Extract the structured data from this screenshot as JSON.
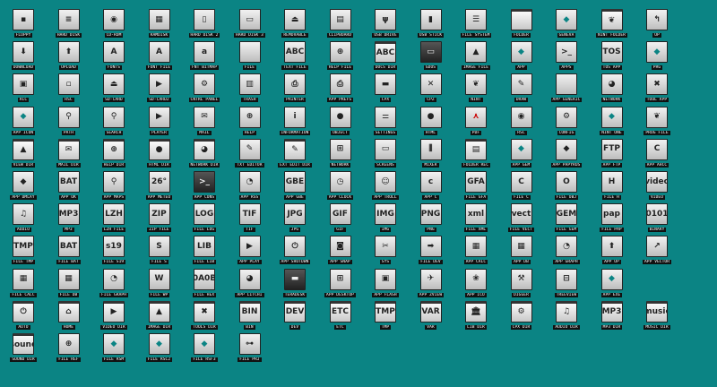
{
  "desktop": {
    "background": "#0b8484",
    "icons": [
      {
        "label": "FLOPPY",
        "icon": "floppy-icon",
        "sym": "▪"
      },
      {
        "label": "HARD DISK",
        "icon": "hard-disk-icon",
        "sym": "≡"
      },
      {
        "label": "CD-ROM",
        "icon": "cd-rom-icon",
        "sym": "◉"
      },
      {
        "label": "RAMDISK",
        "icon": "ramdisk-icon",
        "sym": "▦"
      },
      {
        "label": "HARD DISK 2",
        "icon": "hard-disk-2-icon",
        "sym": "▯"
      },
      {
        "label": "HARD DISK 3",
        "icon": "hard-disk-3-icon",
        "sym": "▭"
      },
      {
        "label": "REMOVABLE",
        "icon": "removable-icon",
        "sym": "⏏"
      },
      {
        "label": "CLIPBOARD",
        "icon": "clipboard-icon",
        "sym": "▤"
      },
      {
        "label": "USB DRIVE",
        "icon": "usb-drive-icon",
        "sym": "ψ"
      },
      {
        "label": "USB STICK",
        "icon": "usb-stick-icon",
        "sym": "▮"
      },
      {
        "label": "FILE SYSTEM",
        "icon": "file-system-icon",
        "sym": "☰"
      },
      {
        "label": "FOLDER",
        "icon": "folder-icon",
        "sym": "",
        "kind": "folder"
      },
      {
        "label": "GENEVA",
        "icon": "geneva-icon",
        "sym": "◆",
        "kind": "teal"
      },
      {
        "label": "NINT FOLDER",
        "icon": "nint-folder-icon",
        "sym": "❦",
        "kind": "folder"
      },
      {
        "label": "UP",
        "icon": "up-arrow-icon",
        "sym": "↰"
      },
      {
        "label": "DOWNLOAD",
        "icon": "download-icon",
        "sym": "⬇"
      },
      {
        "label": "UPLOAD",
        "icon": "upload-icon",
        "sym": "⬆"
      },
      {
        "label": "FONTS",
        "icon": "fonts-icon",
        "sym": "A"
      },
      {
        "label": "FONT FILE",
        "icon": "font-file-icon",
        "sym": "A"
      },
      {
        "label": "FNT BITMAP",
        "icon": "fnt-bitmap-icon",
        "sym": "a"
      },
      {
        "label": "FILE",
        "icon": "file-icon",
        "sym": ""
      },
      {
        "label": "TEXT FILE",
        "icon": "text-file-icon",
        "sym": "ABC"
      },
      {
        "label": "HELP FILE",
        "icon": "help-file-icon",
        "sym": "⊕"
      },
      {
        "label": "DOCS DIR",
        "icon": "docs-dir-icon",
        "sym": "ABC",
        "kind": "folder"
      },
      {
        "label": "GDOS",
        "icon": "gdos-icon",
        "sym": "▭",
        "kind": "dark"
      },
      {
        "label": "IMAGE FILE",
        "icon": "image-file-icon",
        "sym": "▲"
      },
      {
        "label": "APP",
        "icon": "app-icon",
        "sym": "◆",
        "kind": "teal"
      },
      {
        "label": "APPS",
        "icon": "apps-icon",
        "sym": ">_"
      },
      {
        "label": "TOS APP",
        "icon": "tos-app-icon",
        "sym": "TOS"
      },
      {
        "label": "PRG",
        "icon": "prg-icon",
        "sym": "◆",
        "kind": "teal"
      },
      {
        "label": "ACC",
        "icon": "acc-icon",
        "sym": "▣"
      },
      {
        "label": "RSC",
        "icon": "rsc-icon",
        "sym": "▫"
      },
      {
        "label": "SD-CARD",
        "icon": "sd-card-icon",
        "sym": "⏏"
      },
      {
        "label": "SD-CARD2",
        "icon": "sd-card-2-icon",
        "sym": "▶"
      },
      {
        "label": "CNTRL PANEL",
        "icon": "control-panel-icon",
        "sym": "⚙"
      },
      {
        "label": "TRASH",
        "icon": "trash-icon",
        "sym": "▥"
      },
      {
        "label": "PRINTER",
        "icon": "printer-icon",
        "sym": "⎙"
      },
      {
        "label": "APP PREFS",
        "icon": "app-prefs-icon",
        "sym": "⎙"
      },
      {
        "label": "CPX",
        "icon": "cpx-icon",
        "sym": "▬"
      },
      {
        "label": "CPZ",
        "icon": "cpz-icon",
        "sym": "✕"
      },
      {
        "label": "NINT",
        "icon": "nint-icon",
        "sym": "❦"
      },
      {
        "label": "DRAW",
        "icon": "draw-icon",
        "sym": "✎"
      },
      {
        "label": "APP GENERIC",
        "icon": "app-generic-icon",
        "sym": ""
      },
      {
        "label": "NETWORK",
        "icon": "network-icon",
        "sym": "◕"
      },
      {
        "label": "TOOL APP",
        "icon": "tool-app-icon",
        "sym": "✖"
      },
      {
        "label": "APP ICON",
        "icon": "app-icon-icon",
        "sym": "◆",
        "kind": "teal"
      },
      {
        "label": "PATH",
        "icon": "path-icon",
        "sym": "⚲"
      },
      {
        "label": "SEARCH",
        "icon": "search-icon",
        "sym": "⚲"
      },
      {
        "label": "PLAYER",
        "icon": "player-icon",
        "sym": "▶"
      },
      {
        "label": "MAIL",
        "icon": "mail-icon",
        "sym": "✉"
      },
      {
        "label": "HELP",
        "icon": "help-icon",
        "sym": "⊕"
      },
      {
        "label": "INFORMATION",
        "icon": "information-icon",
        "sym": "i"
      },
      {
        "label": "OBJECT",
        "icon": "object-icon",
        "sym": "●"
      },
      {
        "label": "SETTINGS",
        "icon": "settings-icon",
        "sym": "⚌"
      },
      {
        "label": "HTML",
        "icon": "html-icon",
        "sym": "●"
      },
      {
        "label": "PDF",
        "icon": "pdf-icon",
        "sym": "⋏",
        "kind": "red"
      },
      {
        "label": "RSC",
        "icon": "rsc-2-icon",
        "sym": "◉"
      },
      {
        "label": "CONFIG",
        "icon": "config-icon",
        "sym": "⚙"
      },
      {
        "label": "NINT ONE",
        "icon": "nint-one-icon",
        "sym": "◆",
        "kind": "teal"
      },
      {
        "label": "PROG FILE",
        "icon": "prog-file-icon",
        "sym": "❦"
      },
      {
        "label": "VIEW DIR",
        "icon": "view-dir-icon",
        "sym": "▲",
        "kind": "folder"
      },
      {
        "label": "MAIL DIR",
        "icon": "mail-dir-icon",
        "sym": "✉",
        "kind": "folder"
      },
      {
        "label": "HELP DIR",
        "icon": "help-dir-icon",
        "sym": "⊕",
        "kind": "folder"
      },
      {
        "label": "HTML DIR",
        "icon": "html-dir-icon",
        "sym": "●",
        "kind": "folder"
      },
      {
        "label": "NETWORK DIR",
        "icon": "network-dir-icon",
        "sym": "◕",
        "kind": "folder"
      },
      {
        "label": "TXT EDITOR",
        "icon": "txt-editor-icon",
        "sym": "✎"
      },
      {
        "label": "EXT EDIT DIR",
        "icon": "ext-edit-dir-icon",
        "sym": "✎",
        "kind": "folder"
      },
      {
        "label": "NETWORK",
        "icon": "network-2-icon",
        "sym": "⊞"
      },
      {
        "label": "SCREENS",
        "icon": "screens-icon",
        "sym": "▭"
      },
      {
        "label": "MIXER",
        "icon": "mixer-icon",
        "sym": "⫼"
      },
      {
        "label": "FOLDER REC",
        "icon": "folder-rec-icon",
        "sym": "▤",
        "kind": "folder"
      },
      {
        "label": "APP GEM",
        "icon": "app-gem-icon",
        "sym": "◆",
        "kind": "teal"
      },
      {
        "label": "APP PAPYRUS",
        "icon": "app-papyrus-icon",
        "sym": "◆"
      },
      {
        "label": "APP FTP",
        "icon": "app-ftp-icon",
        "sym": "FTP"
      },
      {
        "label": "APP AHCC",
        "icon": "app-ahcc-icon",
        "sym": "C"
      },
      {
        "label": "APP DMLAY",
        "icon": "app-dmlay-icon",
        "sym": "◆"
      },
      {
        "label": "APP OK",
        "icon": "app-ok-icon",
        "sym": "BAT"
      },
      {
        "label": "APP MAPS",
        "icon": "app-maps-icon",
        "sym": "⚲"
      },
      {
        "label": "APP METEO",
        "icon": "app-meteo-icon",
        "sym": "26°"
      },
      {
        "label": "APP CONS",
        "icon": "app-cons-icon",
        "sym": ">_",
        "kind": "dark"
      },
      {
        "label": "APP RSS",
        "icon": "app-rss-icon",
        "sym": "◔"
      },
      {
        "label": "APP GBE",
        "icon": "app-gbe-icon",
        "sym": "GBE"
      },
      {
        "label": "APP CLOCK",
        "icon": "app-clock-icon",
        "sym": "◷"
      },
      {
        "label": "APP TROLL",
        "icon": "app-troll-icon",
        "sym": "☺"
      },
      {
        "label": "APP C",
        "icon": "app-c-icon",
        "sym": "c"
      },
      {
        "label": "FILE GFA",
        "icon": "file-gfa-icon",
        "sym": "GFA"
      },
      {
        "label": "FILE C",
        "icon": "file-c-icon",
        "sym": "C"
      },
      {
        "label": "FILE OBJ",
        "icon": "file-obj-icon",
        "sym": "O"
      },
      {
        "label": "FILE H",
        "icon": "file-h-icon",
        "sym": "H"
      },
      {
        "label": "VIDEO",
        "icon": "video-icon",
        "sym": "video"
      },
      {
        "label": "AUDIO",
        "icon": "audio-icon",
        "sym": "♫"
      },
      {
        "label": "MP3",
        "icon": "mp3-icon",
        "sym": "MP3"
      },
      {
        "label": "LZH FILE",
        "icon": "lzh-file-icon",
        "sym": "LZH"
      },
      {
        "label": "ZIP FILE",
        "icon": "zip-file-icon",
        "sym": "ZIP"
      },
      {
        "label": "FILE LOG",
        "icon": "file-log-icon",
        "sym": "LOG"
      },
      {
        "label": "TIF",
        "icon": "tif-icon",
        "sym": "TIF"
      },
      {
        "label": "JPG",
        "icon": "jpg-icon",
        "sym": "JPG"
      },
      {
        "label": "GIF",
        "icon": "gif-icon",
        "sym": "GIF"
      },
      {
        "label": "IMG",
        "icon": "img-icon",
        "sym": "IMG"
      },
      {
        "label": "PNG",
        "icon": "png-icon",
        "sym": "PNG"
      },
      {
        "label": "FILE XML",
        "icon": "file-xml-icon",
        "sym": "xml"
      },
      {
        "label": "FILE VECT",
        "icon": "file-vect-icon",
        "sym": "vect"
      },
      {
        "label": "FILE GEM",
        "icon": "file-gem-icon",
        "sym": "GEM"
      },
      {
        "label": "FILE PAP",
        "icon": "file-pap-icon",
        "sym": "pap"
      },
      {
        "label": "BINARY",
        "icon": "binary-icon",
        "sym": "0101"
      },
      {
        "label": "FILE TMP",
        "icon": "file-tmp-icon",
        "sym": "TMP"
      },
      {
        "label": "FILE BAT",
        "icon": "file-bat-icon",
        "sym": "BAT"
      },
      {
        "label": "FILE S19",
        "icon": "file-s19-icon",
        "sym": "s19"
      },
      {
        "label": "FILE S",
        "icon": "file-s-icon",
        "sym": "S"
      },
      {
        "label": "FILE LIB",
        "icon": "file-lib-icon",
        "sym": "LIB"
      },
      {
        "label": "APP PLAY",
        "icon": "app-play-icon",
        "sym": "▶"
      },
      {
        "label": "APP SHUTDWN",
        "icon": "app-shutdown-icon",
        "sym": "⏻"
      },
      {
        "label": "APP SNAP",
        "icon": "app-snap-icon",
        "sym": "◙"
      },
      {
        "label": "SYS",
        "icon": "sys-icon",
        "sym": "✂"
      },
      {
        "label": "FILE DEV",
        "icon": "file-dev-icon",
        "sym": "➡"
      },
      {
        "label": "APP CALC",
        "icon": "app-calc-icon",
        "sym": "▦"
      },
      {
        "label": "APP DB",
        "icon": "app-db-icon",
        "sym": "▦"
      },
      {
        "label": "APP GRAPH",
        "icon": "app-graph-icon",
        "sym": "◔"
      },
      {
        "label": "APP UP",
        "icon": "app-up-icon",
        "sym": "⬆"
      },
      {
        "label": "APP VECTOR",
        "icon": "app-vector-icon",
        "sym": "↗"
      },
      {
        "label": "FILE CALC",
        "icon": "file-calc-icon",
        "sym": "▦"
      },
      {
        "label": "FILE DB",
        "icon": "file-db-icon",
        "sym": "▦"
      },
      {
        "label": "FILE GRAPH",
        "icon": "file-graph-icon",
        "sym": "◔"
      },
      {
        "label": "FILE WP",
        "icon": "file-wp-icon",
        "sym": "W"
      },
      {
        "label": "FILE HEX",
        "icon": "file-hex-icon",
        "sym": "0A0B"
      },
      {
        "label": "APP LITCHI",
        "icon": "app-litchi-icon",
        "sym": "◕"
      },
      {
        "label": "TERADESK",
        "icon": "teradesk-icon",
        "sym": "▬",
        "kind": "dark"
      },
      {
        "label": "APP DESKTOP",
        "icon": "app-desktop-icon",
        "sym": "⊞"
      },
      {
        "label": "APP FLASH",
        "icon": "app-flash-icon",
        "sym": "▣"
      },
      {
        "label": "APP ZVIEW",
        "icon": "app-zview-icon",
        "sym": "✈"
      },
      {
        "label": "APP ICO",
        "icon": "app-ico-icon",
        "sym": "❀"
      },
      {
        "label": "DIGGER",
        "icon": "digger-icon",
        "sym": "⚒"
      },
      {
        "label": "TREEVIEW",
        "icon": "treeview-icon",
        "sym": "⊟"
      },
      {
        "label": "APP EXE",
        "icon": "app-exe-icon",
        "sym": "◆",
        "kind": "teal"
      },
      {
        "label": "AUTO",
        "icon": "auto-icon",
        "sym": "⏻",
        "kind": "folder"
      },
      {
        "label": "HOME",
        "icon": "home-icon",
        "sym": "⌂",
        "kind": "folder"
      },
      {
        "label": "VIDEO DIR",
        "icon": "video-dir-icon",
        "sym": "▶",
        "kind": "folder"
      },
      {
        "label": "IMAGE DIR",
        "icon": "image-dir-icon",
        "sym": "▲",
        "kind": "folder"
      },
      {
        "label": "TOOLS DIR",
        "icon": "tools-dir-icon",
        "sym": "✖",
        "kind": "folder"
      },
      {
        "label": "BIN",
        "icon": "bin-icon",
        "sym": "BIN",
        "kind": "folder"
      },
      {
        "label": "DEV",
        "icon": "dev-icon",
        "sym": "DEV",
        "kind": "folder"
      },
      {
        "label": "ETC",
        "icon": "etc-icon",
        "sym": "ETC",
        "kind": "folder"
      },
      {
        "label": "TMP",
        "icon": "tmp-icon",
        "sym": "TMP",
        "kind": "folder"
      },
      {
        "label": "VAR",
        "icon": "var-icon",
        "sym": "VAR",
        "kind": "folder"
      },
      {
        "label": "LIB DIR",
        "icon": "lib-dir-icon",
        "sym": "🏛",
        "kind": "folder"
      },
      {
        "label": "CPX DIR",
        "icon": "cpx-dir-icon",
        "sym": "⚙",
        "kind": "folder"
      },
      {
        "label": "AUDIO DIR",
        "icon": "audio-dir-icon",
        "sym": "♫",
        "kind": "folder"
      },
      {
        "label": "MP3 DIR",
        "icon": "mp3-dir-icon",
        "sym": "MP3",
        "kind": "folder"
      },
      {
        "label": "MUSIC DIR",
        "icon": "music-dir-icon",
        "sym": "music",
        "kind": "folder"
      },
      {
        "label": "SOUND DIR",
        "icon": "sound-dir-icon",
        "sym": "sound",
        "kind": "folder"
      },
      {
        "label": "FILE REF",
        "icon": "file-ref-icon",
        "sym": "⊕"
      },
      {
        "label": "FILE RSM",
        "icon": "file-rsm-icon",
        "sym": "◆",
        "kind": "teal"
      },
      {
        "label": "FILE RSC2",
        "icon": "file-rsc2-icon",
        "sym": "◆",
        "kind": "teal"
      },
      {
        "label": "FILE RSF3",
        "icon": "file-rsf3-icon",
        "sym": "◆",
        "kind": "teal"
      },
      {
        "label": "FILE PRJ",
        "icon": "file-prj-icon",
        "sym": "⊶"
      }
    ]
  }
}
